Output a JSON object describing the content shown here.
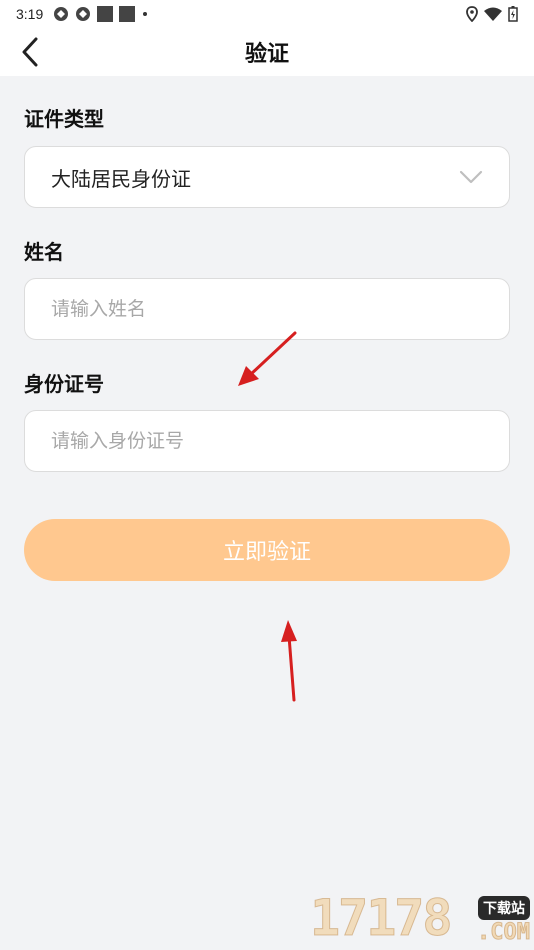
{
  "status_bar": {
    "time": "3:19"
  },
  "nav": {
    "title": "验证"
  },
  "form": {
    "id_type_label": "证件类型",
    "id_type_value": "大陆居民身份证",
    "name_label": "姓名",
    "name_placeholder": "请输入姓名",
    "id_number_label": "身份证号",
    "id_number_placeholder": "请输入身份证号",
    "submit_label": "立即验证"
  },
  "watermark": {
    "number": "17178",
    "suffix": ".COM",
    "tag": "下载站"
  },
  "colors": {
    "accent": "#ffc88f",
    "background": "#f2f3f5",
    "arrow": "#d61f1f"
  }
}
